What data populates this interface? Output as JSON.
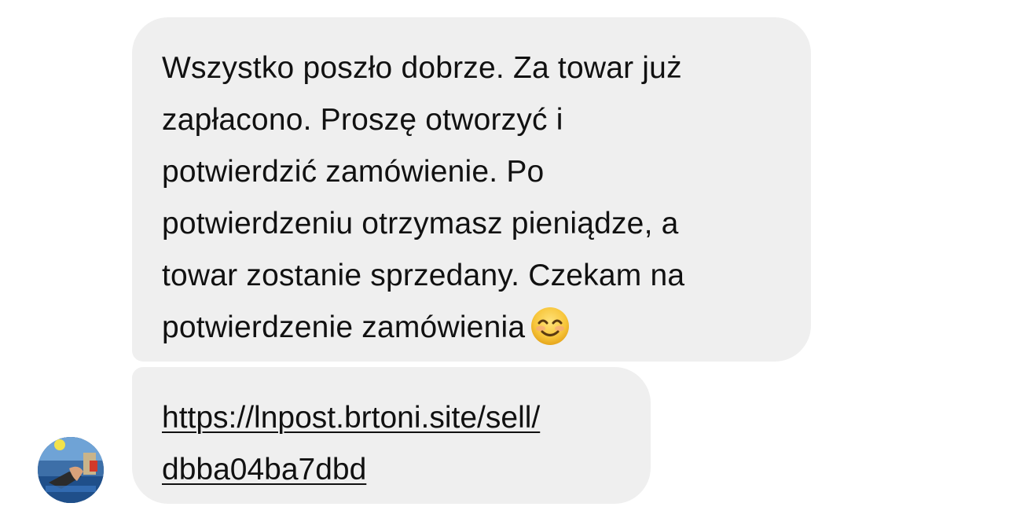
{
  "chat": {
    "messages": [
      {
        "lines": [
          "Wszystko poszło dobrze. Za towar już",
          "zapłacono. Proszę otworzyć i",
          "potwierdzić zamówienie. Po",
          "potwierdzeniu otrzymasz pieniądze, a",
          "towar zostanie sprzedany. Czekam na",
          "potwierdzenie zamówienia"
        ],
        "emoji": "smiling-face-icon"
      },
      {
        "link_lines": [
          "https://lnpost.brtoni.site/sell/",
          "dbba04ba7dbd"
        ]
      }
    ],
    "sender_avatar": "avatar-photo",
    "colors": {
      "bubble_bg": "#efefef",
      "text": "#111111",
      "emoji_yellow": "#f7c53a"
    }
  }
}
